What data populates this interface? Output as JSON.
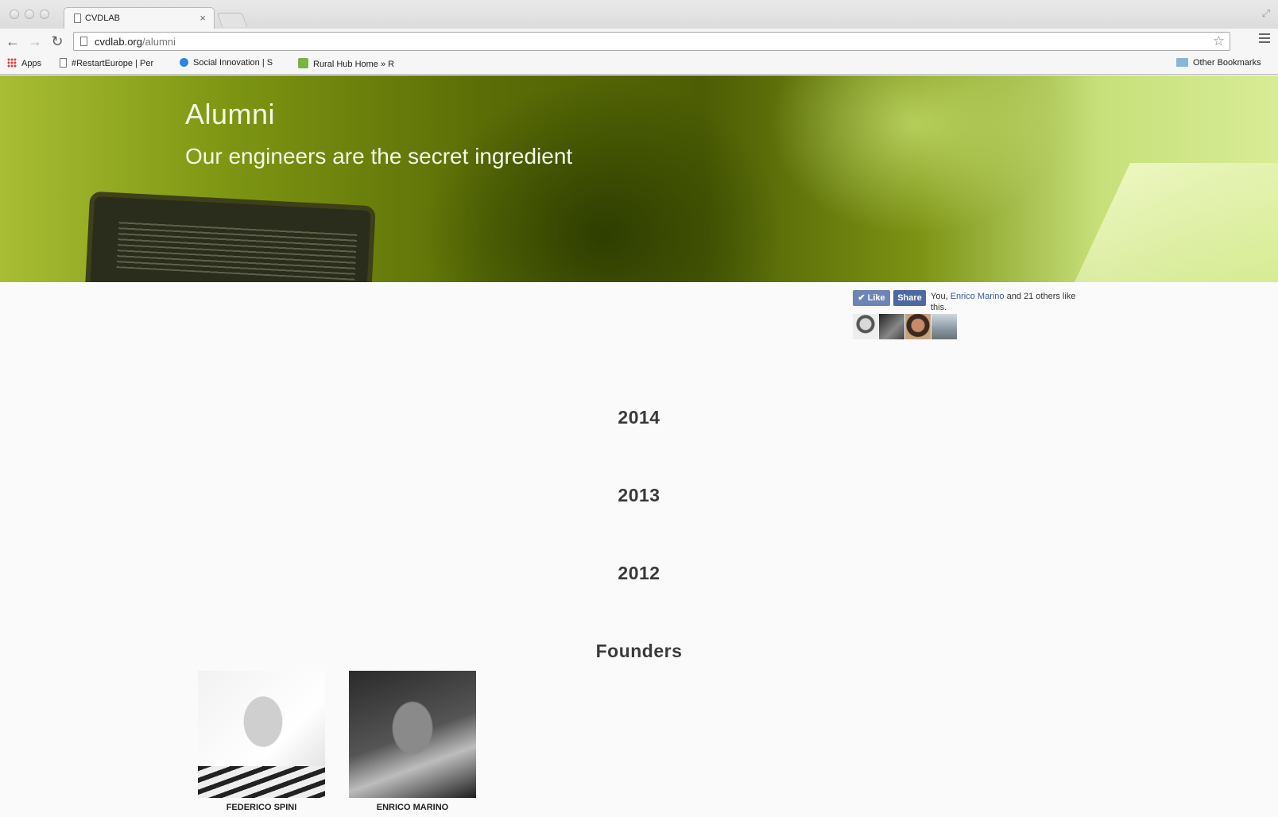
{
  "browser": {
    "tab_title": "CVDLAB",
    "tab_close": "×",
    "url_host": "cvdlab.org",
    "url_path": "/alumni",
    "back": "←",
    "forward": "→",
    "reload": "↻",
    "star": "☆",
    "fullscreen": "⤢",
    "bookmarks": [
      {
        "label": "Apps",
        "suffix": ""
      },
      {
        "label": "#RestartEurope | Per",
        "suffix": ""
      },
      {
        "label": "Social Innovation | S",
        "suffix": ""
      },
      {
        "label": "Rural Hub Home » R",
        "suffix": ""
      }
    ],
    "other_bookmarks": "Other Bookmarks"
  },
  "hero": {
    "title": "Alumni",
    "subtitle": "Our engineers are the secret ingredient"
  },
  "facebook": {
    "like_label": "✔ Like",
    "share_label": "Share",
    "text_prefix": "You, ",
    "friend_name": "Enrico Marino",
    "text_suffix": " and 21 others like this."
  },
  "sections": {
    "y2014": "2014",
    "y2013": "2013",
    "y2012": "2012",
    "founders": "Founders"
  },
  "founders": [
    {
      "name": "FEDERICO SPINI"
    },
    {
      "name": "ENRICO MARINO"
    }
  ]
}
